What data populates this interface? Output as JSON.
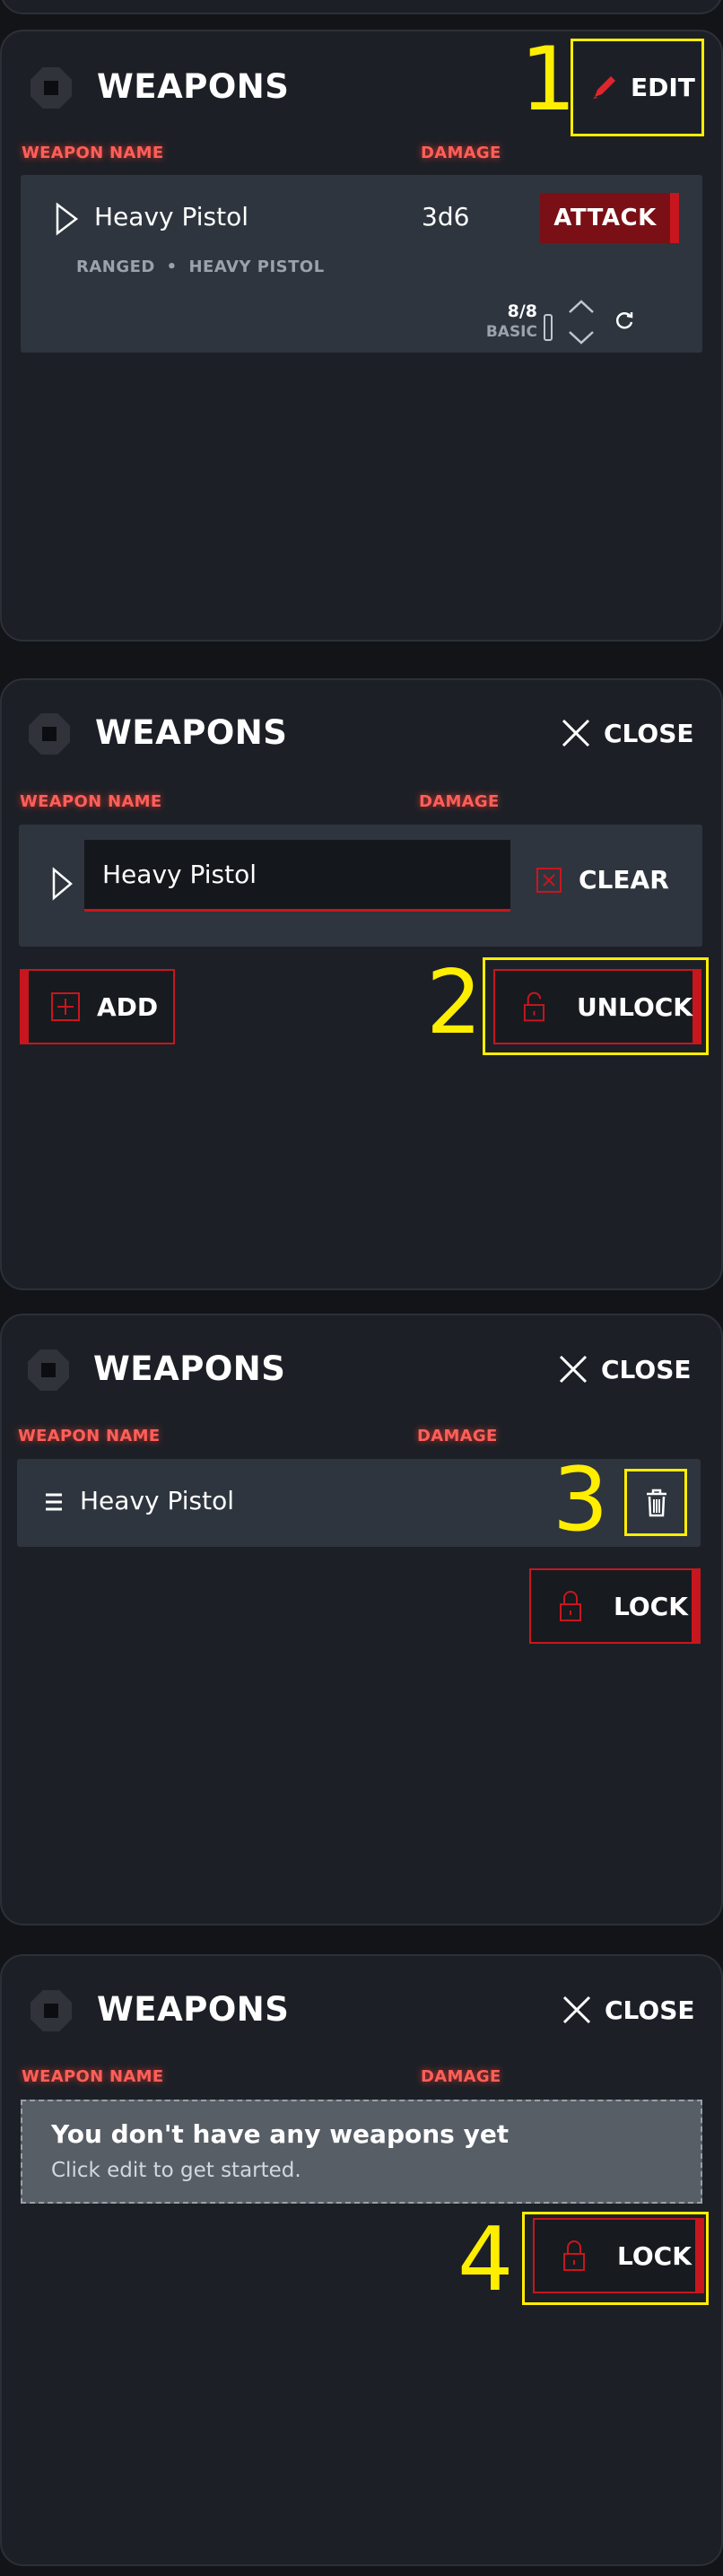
{
  "panel_title": "WEAPONS",
  "columns": {
    "name": "WEAPON NAME",
    "damage": "DAMAGE"
  },
  "panel1": {
    "edit_label": "EDIT",
    "weapon": {
      "name": "Heavy Pistol",
      "damage": "3d6",
      "attack_label": "ATTACK",
      "category": "RANGED",
      "separator": "•",
      "subtype": "HEAVY PISTOL",
      "ammo_count": "8/8",
      "ammo_type": "BASIC"
    }
  },
  "panel2": {
    "close_label": "CLOSE",
    "input_value": "Heavy Pistol",
    "clear_label": "CLEAR",
    "add_label": "ADD",
    "unlock_label": "UNLOCK"
  },
  "panel3": {
    "close_label": "CLOSE",
    "weapon_name": "Heavy Pistol",
    "lock_label": "LOCK"
  },
  "panel4": {
    "close_label": "CLOSE",
    "empty_title": "You don't have any weapons yet",
    "empty_subtitle": "Click edit to get started.",
    "lock_label": "LOCK"
  },
  "annotations": [
    "1",
    "2",
    "3",
    "4"
  ],
  "colors": {
    "accent_red": "#c8161e",
    "label_red": "#ff5f59",
    "highlight_yellow": "#ffee00",
    "panel_bg": "#1c2026",
    "row_bg": "#2e353e"
  },
  "icons": [
    "hexagon-icon",
    "pencil-icon",
    "play-icon",
    "chevron-up-icon",
    "chevron-down-icon",
    "reload-icon",
    "close-icon",
    "clear-icon",
    "plus-icon",
    "unlock-icon",
    "lock-icon",
    "drag-handle-icon",
    "trash-icon"
  ]
}
